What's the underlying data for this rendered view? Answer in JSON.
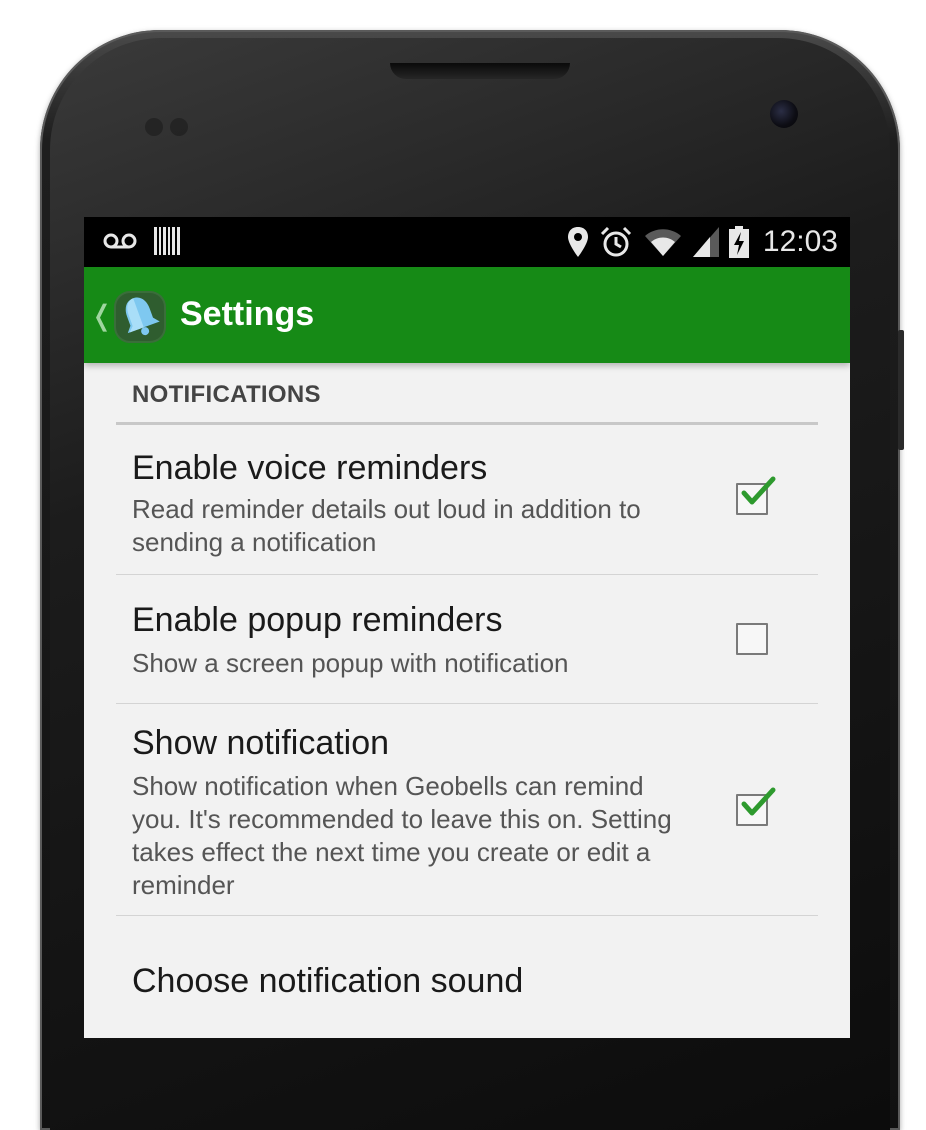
{
  "status_bar": {
    "time": "12:03",
    "icons": [
      "voicemail-icon",
      "barcode-icon",
      "location-pin-icon",
      "alarm-icon",
      "wifi-icon",
      "signal-icon",
      "battery-charging-icon"
    ]
  },
  "action_bar": {
    "title": "Settings",
    "up_icon": "chevron-left-icon",
    "app_icon": "bell-icon"
  },
  "section": {
    "header": "NOTIFICATIONS"
  },
  "prefs": [
    {
      "title": "Enable voice reminders",
      "summary": "Read reminder details out loud in addition to sending a notification",
      "checked": true
    },
    {
      "title": "Enable popup reminders",
      "summary": "Show a screen popup with notification",
      "checked": false
    },
    {
      "title": "Show notification",
      "summary": "Show notification when Geobells can remind you. It's recommended to leave this on. Setting takes effect the next time you create or edit a reminder",
      "checked": true
    },
    {
      "title": "Choose notification sound"
    }
  ],
  "colors": {
    "action_bar": "#168a16",
    "check": "#2e9a2e",
    "background": "#f2f2f2"
  }
}
